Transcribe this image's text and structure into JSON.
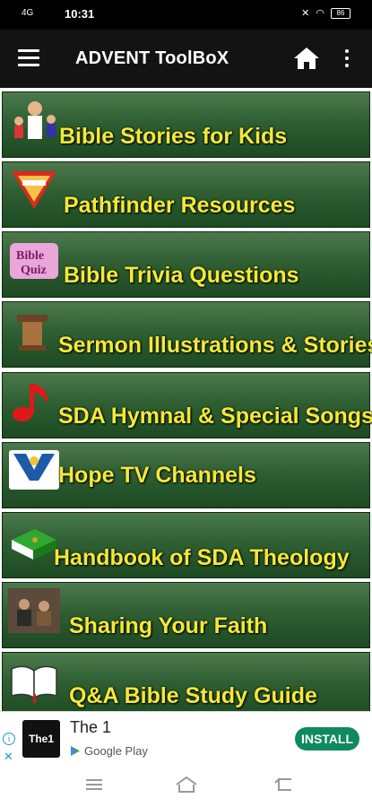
{
  "status": {
    "time": "10:31",
    "signal": "4G",
    "battery": "86"
  },
  "appbar": {
    "title": "ADVENT ToolBoX",
    "menu_icon": "hamburger-icon",
    "home_icon": "home-icon",
    "more_icon": "more-vert-icon"
  },
  "tiles": [
    {
      "label": "Bible Stories for Kids",
      "icon": "children-jesus-icon"
    },
    {
      "label": "Pathfinder Resources",
      "icon": "pathfinder-emblem-icon"
    },
    {
      "label": "Bible Trivia Questions",
      "icon": "bible-quiz-icon"
    },
    {
      "label": "Sermon Illustrations & Stories",
      "icon": "pulpit-icon"
    },
    {
      "label": "SDA Hymnal & Special Songs",
      "icon": "music-note-icon"
    },
    {
      "label": "Hope TV Channels",
      "icon": "hope-channel-icon"
    },
    {
      "label": "Handbook of SDA Theology",
      "icon": "green-book-icon"
    },
    {
      "label": "Sharing Your Faith",
      "icon": "people-sharing-icon"
    },
    {
      "label": "Q&A Bible Study Guide",
      "icon": "open-bible-icon"
    }
  ],
  "ad": {
    "logo_text": "The1",
    "title": "The 1",
    "store": "Google Play",
    "button": "INSTALL"
  },
  "colors": {
    "label": "#f3e83a",
    "tile_top": "#4c7a4c",
    "tile_bottom": "#1d4a22",
    "install": "#0f8a5f"
  }
}
